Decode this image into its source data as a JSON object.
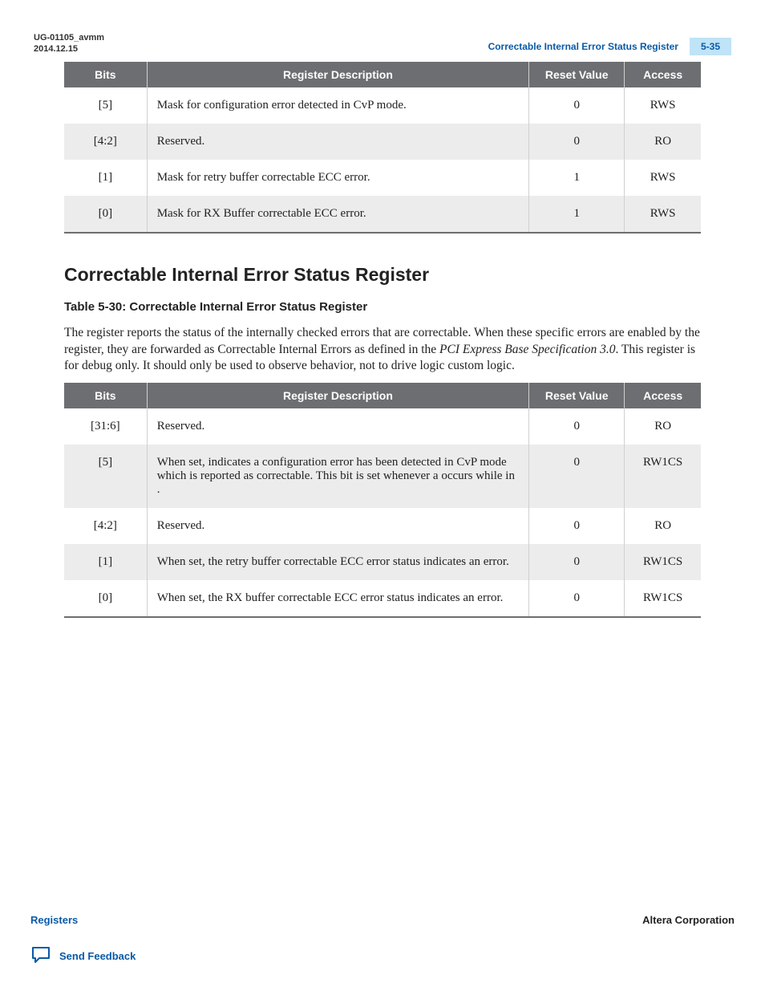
{
  "header": {
    "doc_id": "UG-01105_avmm",
    "date": "2014.12.15",
    "running_title": "Correctable Internal Error Status Register",
    "page": "5-35"
  },
  "table1": {
    "headers": {
      "bits": "Bits",
      "desc": "Register Description",
      "reset": "Reset Value",
      "access": "Access"
    },
    "rows": [
      {
        "bits": "[5]",
        "desc": "Mask for configuration error detected in CvP mode.",
        "reset": "0",
        "access": "RWS"
      },
      {
        "bits": "[4:2]",
        "desc": "Reserved.",
        "reset": "0",
        "access": "RO"
      },
      {
        "bits": "[1]",
        "desc": "Mask for retry buffer correctable ECC error.",
        "reset": "1",
        "access": "RWS"
      },
      {
        "bits": "[0]",
        "desc": "Mask for RX Buffer correctable ECC error.",
        "reset": "1",
        "access": "RWS"
      }
    ]
  },
  "section": {
    "title": "Correctable Internal Error Status Register",
    "table_caption": "Table 5-30: Correctable Internal Error Status Register",
    "para_parts": {
      "p1a": "The ",
      "p1b": " register reports the status of the internally checked errors that are correctable. When these specific errors are enabled by the ",
      "p1c": " register, they are forwarded as Correctable Internal Errors as defined in the ",
      "p1d": "PCI Express Base Specification 3.0",
      "p1e": ". This register is for debug only. It should only be used to observe behavior, not to drive logic custom logic."
    }
  },
  "table2": {
    "headers": {
      "bits": "Bits",
      "desc": "Register Description",
      "reset": "Reset Value",
      "access": "Access"
    },
    "rows": [
      {
        "bits": "[31:6]",
        "desc": "Reserved.",
        "reset": "0",
        "access": "RO"
      },
      {
        "bits": "[5]",
        "desc": "When set, indicates a configuration error has been detected in CvP mode which is reported as correctable. This bit is set whenever a                                    occurs while in                     .",
        "reset": "0",
        "access": "RW1CS"
      },
      {
        "bits": "[4:2]",
        "desc": "Reserved.",
        "reset": "0",
        "access": "RO"
      },
      {
        "bits": "[1]",
        "desc": "When set, the retry buffer correctable ECC error status indicates an error.",
        "reset": "0",
        "access": "RW1CS"
      },
      {
        "bits": "[0]",
        "desc": "When set, the RX buffer correctable ECC error status indicates an error.",
        "reset": "0",
        "access": "RW1CS"
      }
    ]
  },
  "footer": {
    "left": "Registers",
    "right": "Altera Corporation",
    "feedback": "Send Feedback"
  }
}
